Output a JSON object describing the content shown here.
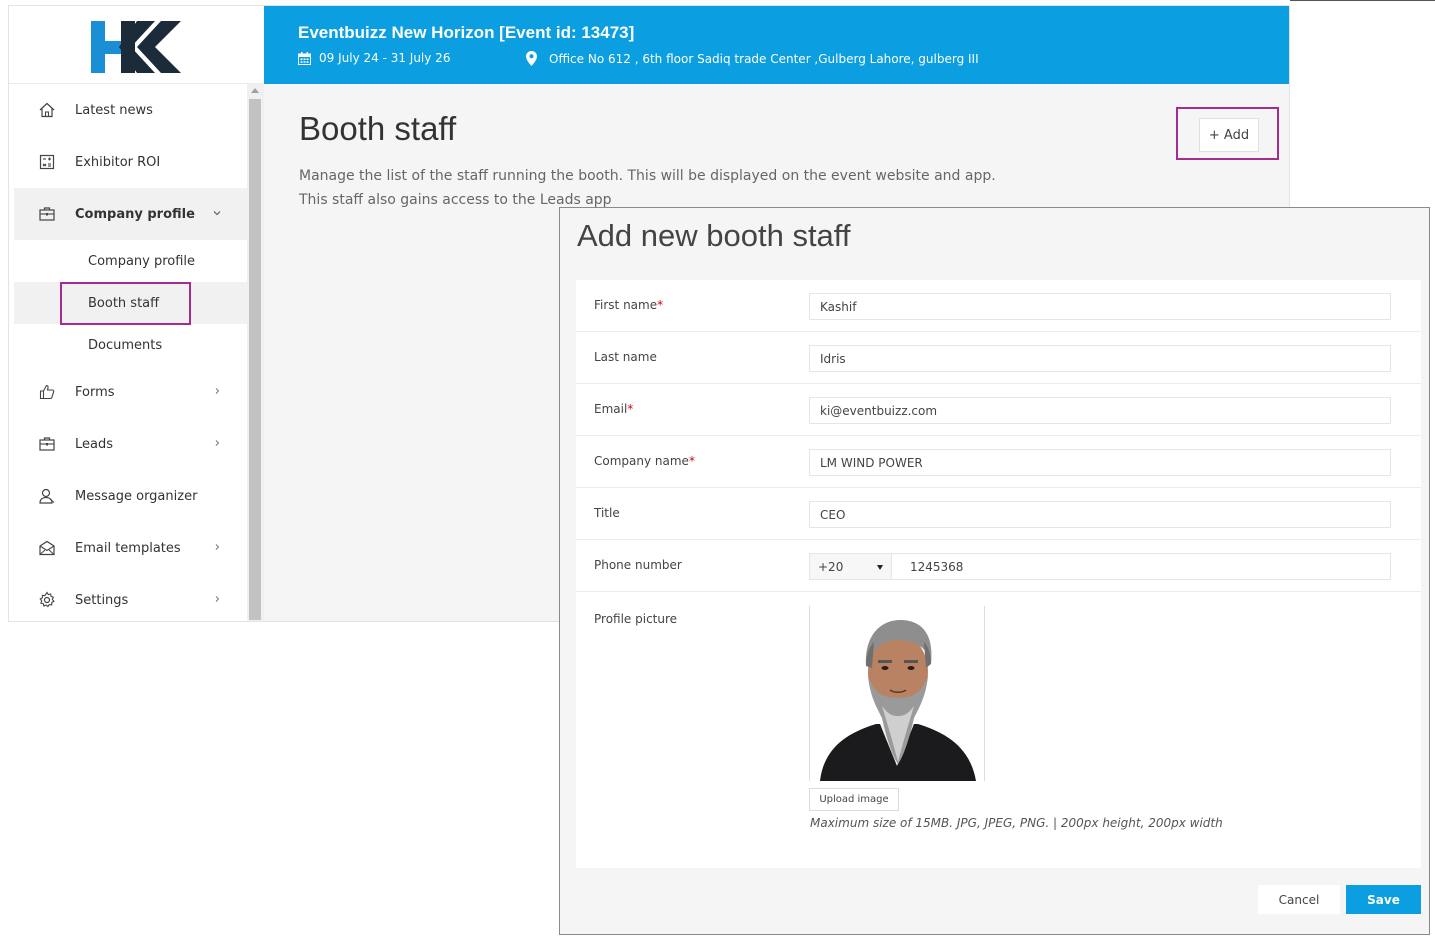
{
  "header": {
    "title": "Eventbuizz New Horizon [Event id: 13473]",
    "date": "09 July 24 - 31 July 26",
    "location": "Office No 612 , 6th floor Sadiq trade Center ,Gulberg Lahore, gulberg III",
    "calendar_icon": "calendar-icon",
    "location_icon": "map-pin-icon"
  },
  "logo": {
    "text": "HK",
    "colors": {
      "primary": "#1a8fd6",
      "dark": "#1c2b3a"
    }
  },
  "sidebar": {
    "items": [
      {
        "label": "Latest news",
        "icon": "home-icon"
      },
      {
        "label": "Exhibitor ROI",
        "icon": "calculator-icon"
      },
      {
        "label": "Company profile",
        "icon": "briefcase-icon",
        "expanded": true
      },
      {
        "label": "Forms",
        "icon": "thumbs-up-icon"
      },
      {
        "label": "Leads",
        "icon": "briefcase-icon"
      },
      {
        "label": "Message organizer",
        "icon": "user-icon"
      },
      {
        "label": "Email templates",
        "icon": "envelope-icon"
      },
      {
        "label": "Settings",
        "icon": "gear-icon"
      }
    ],
    "sub_items": [
      {
        "label": "Company profile"
      },
      {
        "label": "Booth staff",
        "active": true
      },
      {
        "label": "Documents"
      }
    ]
  },
  "main": {
    "title": "Booth staff",
    "description": "Manage the list of the staff running the booth. This will be displayed on the event website and app. This staff also gains access to the Leads app",
    "add_button": "+ Add"
  },
  "modal": {
    "title": "Add new booth staff",
    "fields": {
      "first_name": {
        "label": "First name",
        "required": "*",
        "value": "Kashif"
      },
      "last_name": {
        "label": "Last name",
        "value": "Idris"
      },
      "email": {
        "label": "Email",
        "required": "*",
        "value": "ki@eventbuizz.com"
      },
      "company_name": {
        "label": "Company name",
        "required": "*",
        "value": "LM WIND POWER"
      },
      "title": {
        "label": "Title",
        "value": "CEO"
      },
      "phone": {
        "label": "Phone number",
        "code": "+20",
        "number": "1245368"
      },
      "profile_picture": {
        "label": "Profile picture"
      }
    },
    "upload_button": "Upload image",
    "upload_hint": "Maximum size of 15MB. JPG, JPEG, PNG. | 200px height, 200px width",
    "cancel_button": "Cancel",
    "save_button": "Save"
  },
  "colors": {
    "header_bg": "#0b9ee0",
    "highlight": "#a62b8f",
    "save_bg": "#0b9ee0",
    "required": "#d0021b"
  }
}
